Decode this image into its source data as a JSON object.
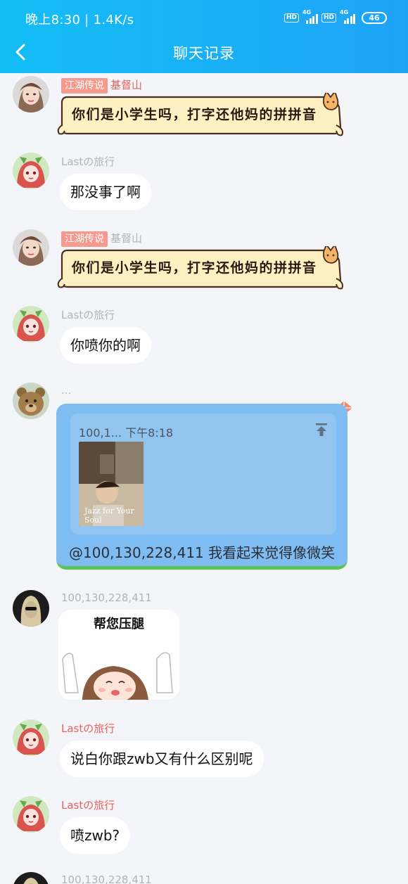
{
  "status_bar": {
    "time": "晚上8:30 | 1.4K/s",
    "hd1": "HD",
    "net1": "4G",
    "hd2": "HD",
    "net2": "4G",
    "battery": "46"
  },
  "header": {
    "title": "聊天记录",
    "back_icon": "chevron-left-icon"
  },
  "messages": [
    {
      "badge": "江湖传说",
      "sender": "基督山",
      "text": "你们是小学生吗，打字还他妈的拼拼音",
      "style": "fancy-bubble"
    },
    {
      "sender": "Lastの旅行",
      "text": "那没事了啊"
    },
    {
      "badge": "江湖传说",
      "sender": "基督山",
      "text": "你们是小学生吗，打字还他妈的拼拼音",
      "style": "fancy-bubble"
    },
    {
      "sender": "Lastの旅行",
      "text": "你喷你的啊"
    },
    {
      "sender": "...",
      "quote_header": "100,1... 下午8:18",
      "thumb_caption": "Jazz for Your Soul",
      "text": "@100,130,228,411 我看起来觉得像微笑"
    },
    {
      "sender": "100,130,228,411",
      "sticker_text": "帮您压腿"
    },
    {
      "sender": "Lastの旅行",
      "text": "说白你跟zwb又有什么区别呢"
    },
    {
      "sender": "Lastの旅行",
      "text": "喷zwb?"
    },
    {
      "sender": "100,130,228,411"
    }
  ],
  "colors": {
    "header_start": "#14bdf6",
    "header_end": "#1fa3f6",
    "background": "#f3f5f9",
    "badge": "#f59a8c",
    "name_red": "#e8615e",
    "quote_bubble": "#7fbcf2"
  }
}
